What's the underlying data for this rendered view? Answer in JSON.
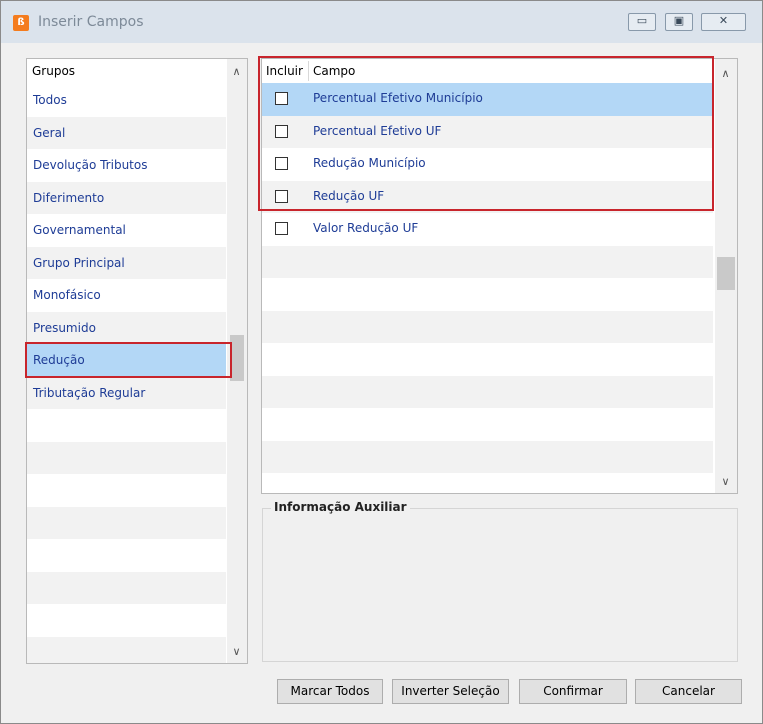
{
  "window": {
    "title": "Inserir Campos",
    "app_icon": "app-logo-icon",
    "controls": {
      "minimize": "▭",
      "maximize": "▣",
      "close": "✕"
    }
  },
  "groups": {
    "header": "Grupos",
    "items": [
      {
        "label": "Todos"
      },
      {
        "label": "Geral"
      },
      {
        "label": "Devolução Tributos"
      },
      {
        "label": "Diferimento"
      },
      {
        "label": "Governamental"
      },
      {
        "label": "Grupo Principal"
      },
      {
        "label": "Monofásico"
      },
      {
        "label": "Presumido"
      },
      {
        "label": "Redução",
        "selected": true
      },
      {
        "label": "Tributação Regular"
      }
    ]
  },
  "fields": {
    "header_incluir": "Incluir",
    "header_campo": "Campo",
    "items": [
      {
        "label": "Percentual Efetivo Município",
        "checked": false,
        "selected": true
      },
      {
        "label": "Percentual Efetivo UF",
        "checked": false
      },
      {
        "label": "Redução Município",
        "checked": false
      },
      {
        "label": "Redução UF",
        "checked": false
      },
      {
        "label": "Valor Redução UF",
        "checked": false
      }
    ]
  },
  "aux_info": {
    "title": "Informação Auxiliar",
    "text": ""
  },
  "buttons": {
    "mark_all": "Marcar Todos",
    "invert": "Inverter Seleção",
    "confirm": "Confirmar",
    "cancel": "Cancelar"
  },
  "colors": {
    "highlight": "#c8252c",
    "selection": "#b3d7f6",
    "link_text": "#1e3c96"
  }
}
